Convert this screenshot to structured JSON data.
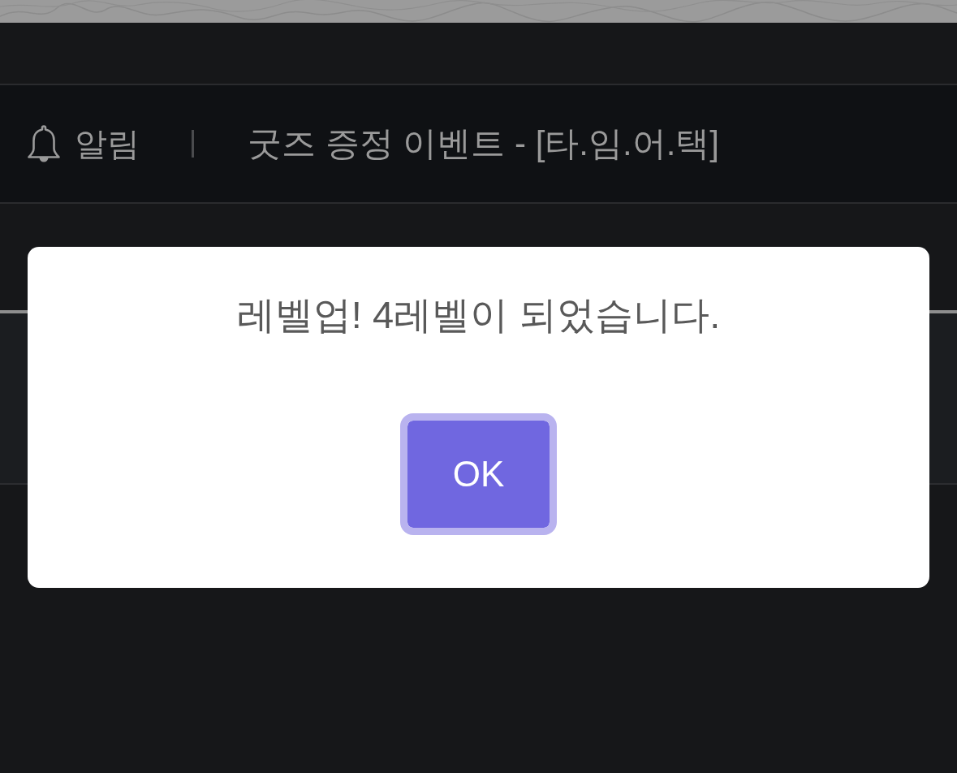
{
  "notice_bar": {
    "label": "알림",
    "text": "굿즈 증정 이벤트 - [타.임.어.택]"
  },
  "dialog": {
    "message": "레벨업! 4레벨이 되었습니다.",
    "button": {
      "label": "OK",
      "focused": true
    }
  }
}
